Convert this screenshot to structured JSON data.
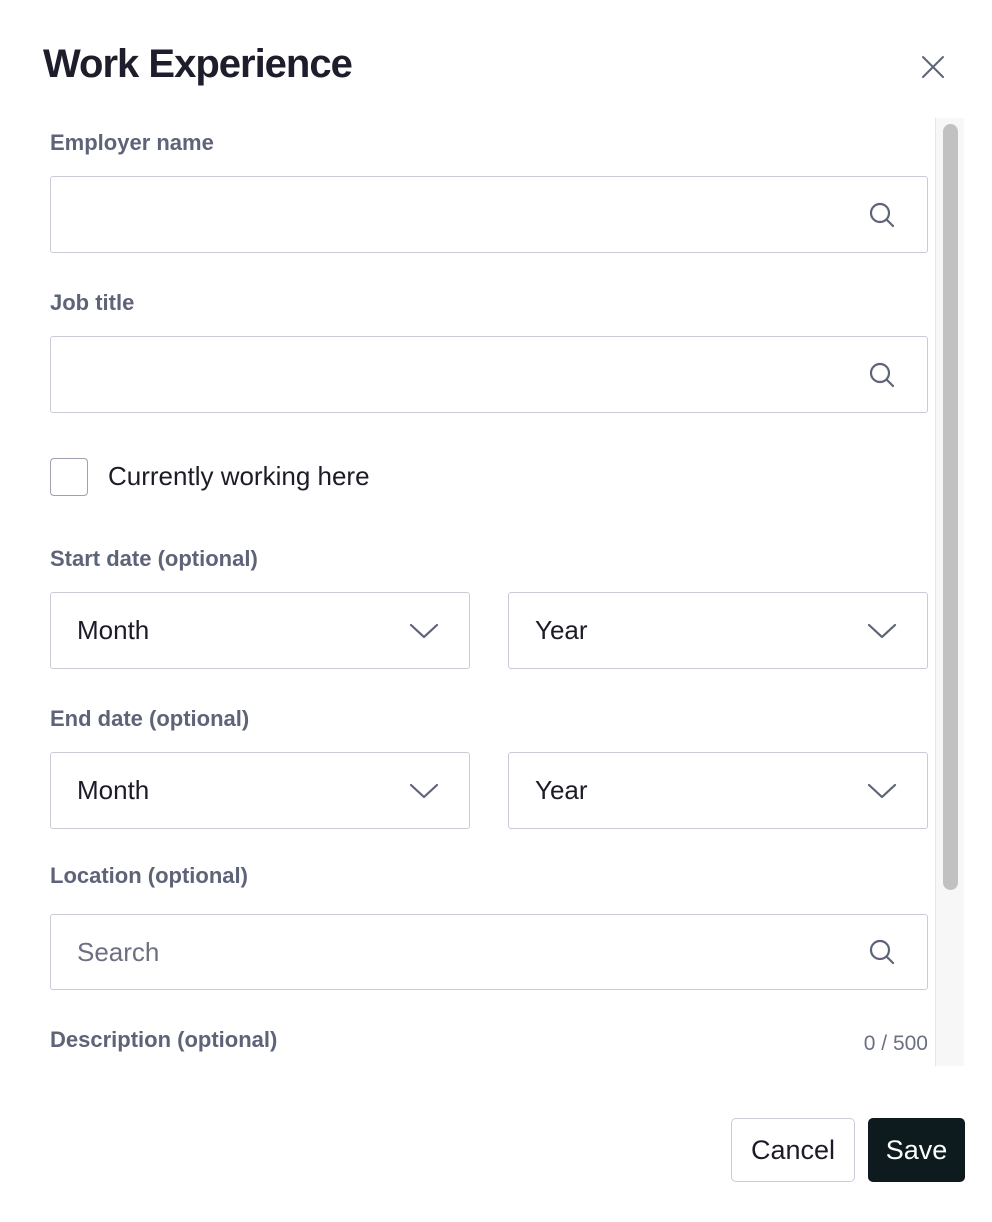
{
  "dialog": {
    "title": "Work Experience",
    "close_icon": "close-icon"
  },
  "form": {
    "employer": {
      "label": "Employer name",
      "value": "",
      "placeholder": "",
      "icon": "search-icon"
    },
    "job_title": {
      "label": "Job title",
      "value": "",
      "placeholder": "",
      "icon": "search-icon"
    },
    "currently_working": {
      "label": "Currently working here",
      "checked": false
    },
    "start_date": {
      "label": "Start date (optional)",
      "month": "Month",
      "year": "Year",
      "icon": "chevron-down-icon"
    },
    "end_date": {
      "label": "End date (optional)",
      "month": "Month",
      "year": "Year",
      "icon": "chevron-down-icon"
    },
    "location": {
      "label": "Location (optional)",
      "value": "",
      "placeholder": "Search",
      "icon": "search-icon"
    },
    "description": {
      "label": "Description (optional)",
      "counter": "0 / 500"
    }
  },
  "footer": {
    "cancel_label": "Cancel",
    "save_label": "Save"
  },
  "colors": {
    "label": "#5e6478",
    "border": "#c9ccd6",
    "save_bg": "#0d1b1e",
    "text": "#1c1c28"
  }
}
